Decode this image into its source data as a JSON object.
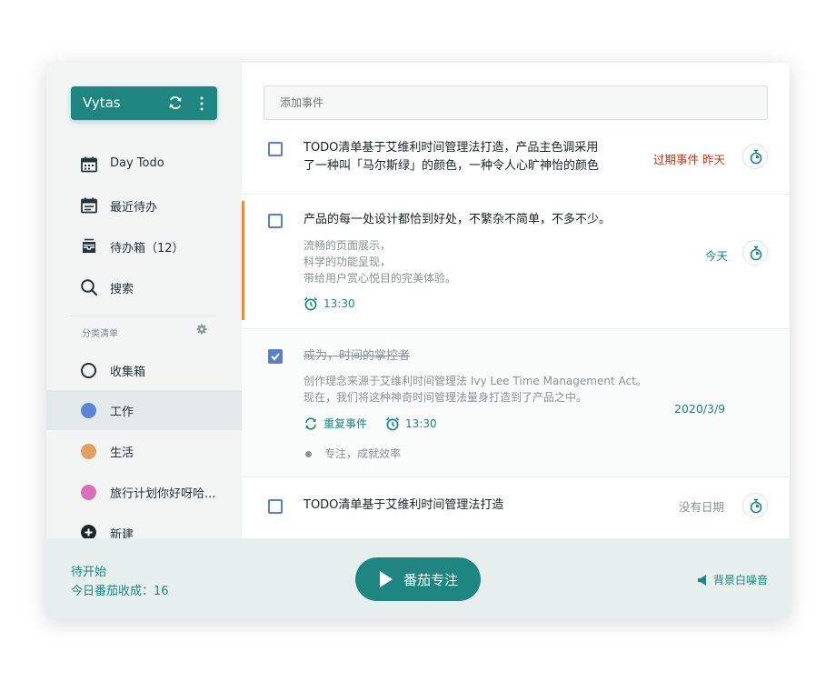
{
  "user": {
    "name": "Vytas"
  },
  "sidebar": {
    "items": [
      {
        "label": "Day  Todo",
        "icon": "calendar-icon"
      },
      {
        "label": "最近待办",
        "icon": "calendar-list-icon"
      },
      {
        "label": "待办箱（12）",
        "icon": "inbox-icon"
      },
      {
        "label": "搜索",
        "icon": "search-icon"
      }
    ],
    "section_title": "分类清单",
    "lists": [
      {
        "label": "收集箱",
        "color": ""
      },
      {
        "label": "工作",
        "color": "#5b84d6"
      },
      {
        "label": "生活",
        "color": "#e0a063"
      },
      {
        "label": "旅行计划你好呀哈...",
        "color": "#d86fb8"
      }
    ],
    "new_label": "新建"
  },
  "main": {
    "add_placeholder": "添加事件",
    "tasks": [
      {
        "title_line1": "TODO清单基于艾维利时间管理法打造，产品主色调采用",
        "title_line2": "了一种叫「马尔斯绿」的颜色，一种令人心旷神怡的颜色",
        "date": "过期事件  昨天",
        "date_color": "#b5391c",
        "checked": false
      },
      {
        "title": "产品的每一处设计都恰到好处，不繁杂不简单，不多不少。",
        "notes": [
          "流畅的页面展示，",
          "科学的功能呈现，",
          "带给用户赏心悦目的完美体验。"
        ],
        "alarm": "13:30",
        "date": "今天",
        "date_color": "#1e8580",
        "checked": false
      },
      {
        "title": "成为，时间的掌控者",
        "notes": [
          "创作理念来源于艾维利时间管理法 Ivy Lee Time Management Act。",
          "现在，我们将这种神奇时间管理法量身打造到了产品之中。"
        ],
        "repeat": "重复事件",
        "alarm": "13:30",
        "subtask": "专注，成就效率",
        "date": "2020/3/9",
        "date_color": "#1e8580",
        "checked": true
      },
      {
        "title": "TODO清单基于艾维利时间管理法打造",
        "date": "没有日期",
        "date_color": "#8a9292",
        "checked": false
      }
    ]
  },
  "footer": {
    "status": "待开始",
    "harvest": "今日番茄收成：16",
    "focus_button": "番茄专注",
    "noise_label": "背景白噪音"
  },
  "colors": {
    "accent": "#1e8580",
    "overdue": "#b5391c",
    "highlight_bar": "#f08a3e",
    "checkbox": "#5b7fc7"
  }
}
